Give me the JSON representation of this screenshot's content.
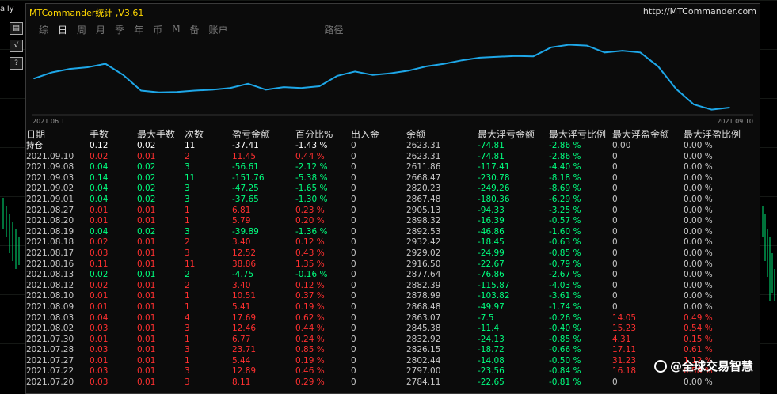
{
  "left_tools": {
    "daily_label": "aily",
    "buttons": [
      "▤",
      "√",
      "?"
    ]
  },
  "window": {
    "title": "MTCommander统计 ,V3.61",
    "url": "http://MTCommander.com",
    "minimize_label": "—"
  },
  "tabs": [
    {
      "label": "综",
      "active": false
    },
    {
      "label": "日",
      "active": true
    },
    {
      "label": "周",
      "active": false
    },
    {
      "label": "月",
      "active": false
    },
    {
      "label": "季",
      "active": false
    },
    {
      "label": "年",
      "active": false
    },
    {
      "label": "币",
      "active": false
    },
    {
      "label": "M",
      "active": false
    },
    {
      "label": "备",
      "active": false
    },
    {
      "label": "账户",
      "active": false
    },
    {
      "label": "路径",
      "active": false
    }
  ],
  "chart_data": {
    "type": "line",
    "x_start_label": "2021.06.11",
    "x_end_label": "2021.09.10",
    "line_color": "#1ea7e8",
    "values": [
      2540,
      2575,
      2595,
      2605,
      2625,
      2560,
      2470,
      2460,
      2462,
      2470,
      2475,
      2485,
      2510,
      2475,
      2490,
      2485,
      2495,
      2555,
      2580,
      2560,
      2570,
      2585,
      2610,
      2625,
      2645,
      2660,
      2665,
      2670,
      2668,
      2720,
      2735,
      2730,
      2690,
      2700,
      2690,
      2610,
      2480,
      2390,
      2360,
      2372
    ],
    "ylim": [
      2340,
      2760
    ]
  },
  "colors": {
    "green": "#00ff7f",
    "red": "#ff3030",
    "white": "#ffffff",
    "gray": "#c8c8c8"
  },
  "table": {
    "headers": [
      "日期",
      "手数",
      "最大手数",
      "次数",
      "盈亏金额",
      "百分比%",
      "出入金",
      "余额",
      "最大浮亏金额",
      "最大浮亏比例",
      "最大浮盈金额",
      "最大浮盈比例"
    ],
    "rows": [
      {
        "c": "w",
        "cells": [
          "持仓",
          "0.12",
          "0.02",
          "11",
          "-37.41",
          "-1.43 %",
          "0",
          "2623.31",
          "-74.81",
          "-2.86 %",
          "0.00",
          "0.00 %"
        ]
      },
      {
        "c": "r",
        "cells": [
          "2021.09.10",
          "0.02",
          "0.01",
          "2",
          "11.45",
          "0.44 %",
          "0",
          "2623.31",
          "-74.81",
          "-2.86 %",
          "0",
          "0.00 %"
        ]
      },
      {
        "c": "g",
        "cells": [
          "2021.09.08",
          "0.04",
          "0.02",
          "3",
          "-56.61",
          "-2.12 %",
          "0",
          "2611.86",
          "-117.41",
          "-4.40 %",
          "0",
          "0.00 %"
        ]
      },
      {
        "c": "g",
        "cells": [
          "2021.09.03",
          "0.14",
          "0.02",
          "11",
          "-151.76",
          "-5.38 %",
          "0",
          "2668.47",
          "-230.78",
          "-8.18 %",
          "0",
          "0.00 %"
        ]
      },
      {
        "c": "g",
        "cells": [
          "2021.09.02",
          "0.04",
          "0.02",
          "3",
          "-47.25",
          "-1.65 %",
          "0",
          "2820.23",
          "-249.26",
          "-8.69 %",
          "0",
          "0.00 %"
        ]
      },
      {
        "c": "g",
        "cells": [
          "2021.09.01",
          "0.04",
          "0.02",
          "3",
          "-37.65",
          "-1.30 %",
          "0",
          "2867.48",
          "-180.36",
          "-6.29 %",
          "0",
          "0.00 %"
        ]
      },
      {
        "c": "r",
        "cells": [
          "2021.08.27",
          "0.01",
          "0.01",
          "1",
          "6.81",
          "0.23 %",
          "0",
          "2905.13",
          "-94.33",
          "-3.25 %",
          "0",
          "0.00 %"
        ]
      },
      {
        "c": "r",
        "cells": [
          "2021.08.20",
          "0.01",
          "0.01",
          "1",
          "5.79",
          "0.20 %",
          "0",
          "2898.32",
          "-16.39",
          "-0.57 %",
          "0",
          "0.00 %"
        ]
      },
      {
        "c": "g",
        "cells": [
          "2021.08.19",
          "0.04",
          "0.02",
          "3",
          "-39.89",
          "-1.36 %",
          "0",
          "2892.53",
          "-46.86",
          "-1.60 %",
          "0",
          "0.00 %"
        ]
      },
      {
        "c": "r",
        "cells": [
          "2021.08.18",
          "0.02",
          "0.01",
          "2",
          "3.40",
          "0.12 %",
          "0",
          "2932.42",
          "-18.45",
          "-0.63 %",
          "0",
          "0.00 %"
        ]
      },
      {
        "c": "r",
        "cells": [
          "2021.08.17",
          "0.03",
          "0.01",
          "3",
          "12.52",
          "0.43 %",
          "0",
          "2929.02",
          "-24.99",
          "-0.85 %",
          "0",
          "0.00 %"
        ]
      },
      {
        "c": "r",
        "cells": [
          "2021.08.16",
          "0.11",
          "0.01",
          "11",
          "38.86",
          "1.35 %",
          "0",
          "2916.50",
          "-22.67",
          "-0.79 %",
          "0",
          "0.00 %"
        ]
      },
      {
        "c": "g",
        "cells": [
          "2021.08.13",
          "0.02",
          "0.01",
          "2",
          "-4.75",
          "-0.16 %",
          "0",
          "2877.64",
          "-76.86",
          "-2.67 %",
          "0",
          "0.00 %"
        ]
      },
      {
        "c": "r",
        "cells": [
          "2021.08.12",
          "0.02",
          "0.01",
          "2",
          "3.40",
          "0.12 %",
          "0",
          "2882.39",
          "-115.87",
          "-4.03 %",
          "0",
          "0.00 %"
        ]
      },
      {
        "c": "r",
        "cells": [
          "2021.08.10",
          "0.01",
          "0.01",
          "1",
          "10.51",
          "0.37 %",
          "0",
          "2878.99",
          "-103.82",
          "-3.61 %",
          "0",
          "0.00 %"
        ]
      },
      {
        "c": "r",
        "cells": [
          "2021.08.09",
          "0.01",
          "0.01",
          "1",
          "5.41",
          "0.19 %",
          "0",
          "2868.48",
          "-49.97",
          "-1.74 %",
          "0",
          "0.00 %"
        ]
      },
      {
        "c": "r",
        "e": true,
        "cells": [
          "2021.08.03",
          "0.04",
          "0.01",
          "4",
          "17.69",
          "0.62 %",
          "0",
          "2863.07",
          "-7.5",
          "-0.26 %",
          "14.05",
          "0.49 %"
        ]
      },
      {
        "c": "r",
        "e": true,
        "cells": [
          "2021.08.02",
          "0.03",
          "0.01",
          "3",
          "12.46",
          "0.44 %",
          "0",
          "2845.38",
          "-11.4",
          "-0.40 %",
          "15.23",
          "0.54 %"
        ]
      },
      {
        "c": "r",
        "e": true,
        "cells": [
          "2021.07.30",
          "0.01",
          "0.01",
          "1",
          "6.77",
          "0.24 %",
          "0",
          "2832.92",
          "-24.13",
          "-0.85 %",
          "4.31",
          "0.15 %"
        ]
      },
      {
        "c": "r",
        "e": true,
        "cells": [
          "2021.07.28",
          "0.03",
          "0.01",
          "3",
          "23.71",
          "0.85 %",
          "0",
          "2826.15",
          "-18.72",
          "-0.66 %",
          "17.11",
          "0.61 %"
        ]
      },
      {
        "c": "r",
        "e": true,
        "cells": [
          "2021.07.27",
          "0.01",
          "0.01",
          "1",
          "5.44",
          "0.19 %",
          "0",
          "2802.44",
          "-14.08",
          "-0.50 %",
          "31.23",
          "1.12 %"
        ]
      },
      {
        "c": "r",
        "e": true,
        "cells": [
          "2021.07.22",
          "0.03",
          "0.01",
          "3",
          "12.89",
          "0.46 %",
          "0",
          "2797.00",
          "-23.56",
          "-0.84 %",
          "16.18",
          "0.58 %"
        ]
      },
      {
        "c": "r",
        "cells": [
          "2021.07.20",
          "0.03",
          "0.01",
          "3",
          "8.11",
          "0.29 %",
          "0",
          "2784.11",
          "-22.65",
          "-0.81 %",
          "0",
          "0.00 %"
        ]
      }
    ]
  },
  "watermark": "@全球交易智慧"
}
